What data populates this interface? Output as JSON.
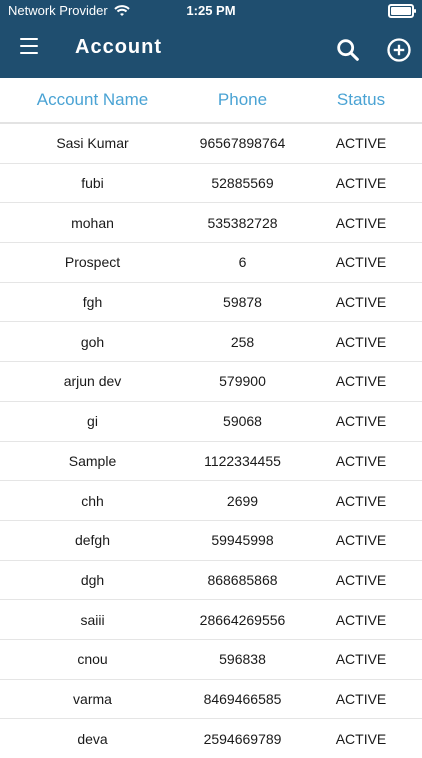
{
  "status_bar": {
    "carrier": "Network Provider",
    "time": "1:25 PM"
  },
  "app_bar": {
    "title": "Account"
  },
  "table": {
    "columns": [
      "Account Name",
      "Phone",
      "Status"
    ],
    "rows": [
      {
        "name": "Sasi Kumar",
        "phone": "96567898764",
        "status": "ACTIVE"
      },
      {
        "name": "fubi",
        "phone": "52885569",
        "status": "ACTIVE"
      },
      {
        "name": "mohan",
        "phone": "535382728",
        "status": "ACTIVE"
      },
      {
        "name": "Prospect",
        "phone": "6",
        "status": "ACTIVE"
      },
      {
        "name": "fgh",
        "phone": "59878",
        "status": "ACTIVE"
      },
      {
        "name": "goh",
        "phone": "258",
        "status": "ACTIVE"
      },
      {
        "name": "arjun dev",
        "phone": "579900",
        "status": "ACTIVE"
      },
      {
        "name": "gi",
        "phone": "59068",
        "status": "ACTIVE"
      },
      {
        "name": "Sample",
        "phone": "1122334455",
        "status": "ACTIVE"
      },
      {
        "name": "chh",
        "phone": "2699",
        "status": "ACTIVE"
      },
      {
        "name": "defgh",
        "phone": "59945998",
        "status": "ACTIVE"
      },
      {
        "name": "dgh",
        "phone": "868685868",
        "status": "ACTIVE"
      },
      {
        "name": "saiii",
        "phone": "28664269556",
        "status": "ACTIVE"
      },
      {
        "name": "cnou",
        "phone": "596838",
        "status": "ACTIVE"
      },
      {
        "name": "varma",
        "phone": "8469466585",
        "status": "ACTIVE"
      },
      {
        "name": "deva",
        "phone": "2594669789",
        "status": "ACTIVE"
      }
    ]
  }
}
